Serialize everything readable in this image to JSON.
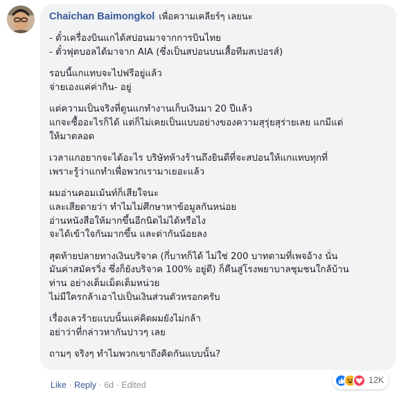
{
  "comment": {
    "author": "Chaichan Baimongkol",
    "lead": "เพื่อความเคลียร์ๆ เลยนะ",
    "paragraphs": [
      [
        "- ตั๋วเครื่องบินแกได้สปอนมาจากการบินไทย",
        "- ตั๋วฟุตบอลได้มาจาก AIA (ซึ่งเป็นสปอนบนเสื้อทีมสเปอรส์)"
      ],
      [
        "รอบนี้แกแทบจะไปฟรีอยู่แล้ว",
        "จ่ายเองแค่ค่ากิน- อยู่"
      ],
      [
        "แต่ความเป็นจริงที่ตูนแกทำงานเก็บเงินมา 20 ปีแล้ว",
        "แกจะซื้ออะไรก็ได้ แต่ก็ไม่เคยเป็นแบบอย่างของความสุรุ่ยสุร่ายเลย แกมีแต่",
        "ให้มาตลอด"
      ],
      [
        "เวลาแกอยากจะได้อะไร บริษัทห้างร้านถึงยินดีที่จะสปอนให้แกแทบทุกที่",
        "เพราะรู้ว่าแกทำเพื่อพวกเรามาเยอะแล้ว"
      ],
      [
        "ผมอ่านคอมเม้นท์ก็เสียใจนะ",
        "และเสียดายว่า ทำไมไม่ศึกษาหาข้อมูลกันหน่อย",
        "อ่านหนังสือให้มากขึ้นอีกนิดไม่ได้หรือไง",
        "จะได้เข้าใจกันมากขึ้น และด่ากันน้อยลง"
      ],
      [
        "สุดท้ายปลายทางเงินบริจาค (กี่บาทก็ได้ ไม่ใช่ 200 บาทตามที่เพจอ้าง นั่น",
        "มันค่าสมัครวิ่ง ซึ่งก็ยังบริจาค 100% อยู่ดี) ก็คืนสู่โรงพยาบาลชุมชนใกล้บ้าน",
        "ท่าน อย่างเต็มเม็ดเต็มหน่วย",
        "ไม่มีใครกล้าเอาไปเป็นเงินส่วนตัวหรอกครับ"
      ],
      [
        "เรื่องเลวร้ายแบบนั้นแค่คิดผมยังไม่กล้า",
        "อย่าว่าที่กล่าวหากันปาวๆ เลย"
      ],
      [
        "ถามๆ จริงๆ ทำไมพวกเขาถึงคิดกันแบบนั้น?"
      ]
    ]
  },
  "actions": {
    "like": "Like",
    "reply": "Reply",
    "separator": "·",
    "time": "6d",
    "edited": "Edited"
  },
  "reactions": {
    "icons": [
      "like-icon",
      "haha-icon",
      "love-icon"
    ],
    "count": "12K"
  },
  "colors": {
    "author": "#385898",
    "bubble": "#f2f3f5",
    "like_blue": "#1877f2",
    "love_red": "#f33e58",
    "haha_yellow": "#f7b125"
  }
}
